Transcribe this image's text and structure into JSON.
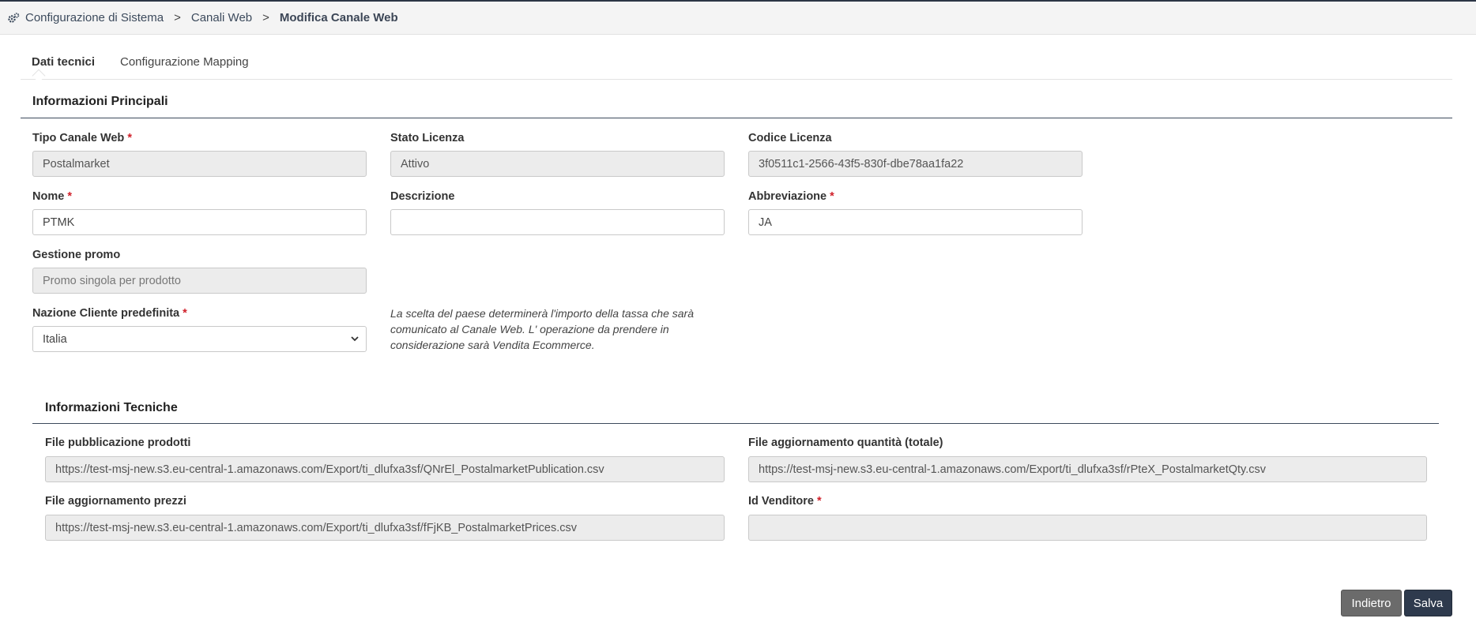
{
  "breadcrumb": {
    "icon": "gears-icon",
    "items": [
      "Configurazione di Sistema",
      "Canali Web"
    ],
    "separator": ">",
    "current": "Modifica Canale Web"
  },
  "tabs": [
    {
      "label": "Dati tecnici",
      "active": true
    },
    {
      "label": "Configurazione Mapping",
      "active": false
    }
  ],
  "main_info": {
    "title": "Informazioni Principali",
    "tipo_canale": {
      "label": "Tipo Canale Web",
      "required": "*",
      "value": "Postalmarket"
    },
    "stato_licenza": {
      "label": "Stato Licenza",
      "value": "Attivo"
    },
    "codice_licenza": {
      "label": "Codice Licenza",
      "value": "3f0511c1-2566-43f5-830f-dbe78aa1fa22"
    },
    "nome": {
      "label": "Nome",
      "required": "*",
      "value": "PTMK"
    },
    "descrizione": {
      "label": "Descrizione",
      "value": ""
    },
    "abbreviazione": {
      "label": "Abbreviazione",
      "required": "*",
      "value": "JA"
    },
    "gestione_promo": {
      "label": "Gestione promo",
      "value": "Promo singola per prodotto"
    },
    "nazione": {
      "label": "Nazione Cliente predefinita",
      "required": "*",
      "value": "Italia"
    },
    "nazione_note": "La scelta del paese determinerà l'importo della tassa che sarà comunicato al Canale Web. L' operazione da prendere in considerazione sarà Vendita Ecommerce."
  },
  "tech_info": {
    "title": "Informazioni Tecniche",
    "file_pubblicazione": {
      "label": "File pubblicazione prodotti",
      "value": "https://test-msj-new.s3.eu-central-1.amazonaws.com/Export/ti_dlufxa3sf/QNrEl_PostalmarketPublication.csv"
    },
    "file_quantita": {
      "label": "File aggiornamento quantità (totale)",
      "value": "https://test-msj-new.s3.eu-central-1.amazonaws.com/Export/ti_dlufxa3sf/rPteX_PostalmarketQty.csv"
    },
    "file_prezzi": {
      "label": "File aggiornamento prezzi",
      "value": "https://test-msj-new.s3.eu-central-1.amazonaws.com/Export/ti_dlufxa3sf/fFjKB_PostalmarketPrices.csv"
    },
    "id_venditore": {
      "label": "Id Venditore",
      "required": "*",
      "value": ""
    }
  },
  "actions": {
    "back": "Indietro",
    "save": "Salva"
  },
  "colors": {
    "accent": "#2e3a4d",
    "required": "#d0202a",
    "readonly_bg": "#ececec"
  }
}
